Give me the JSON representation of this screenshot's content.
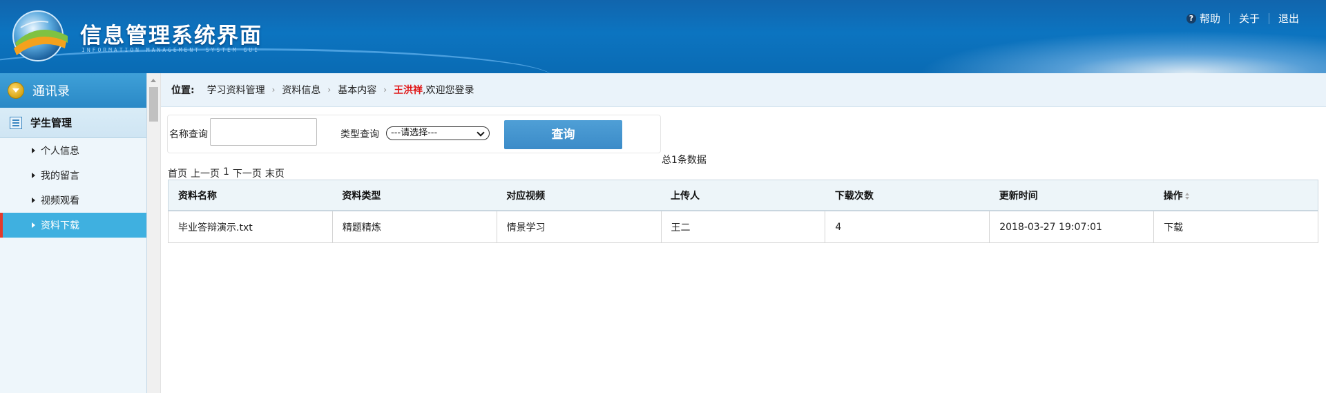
{
  "header": {
    "title": "信息管理系统界面",
    "subtitle": "INFORMATION MANAGEMENT SYSTEM GUI",
    "nav": {
      "help": "帮助",
      "about": "关于",
      "logout": "退出"
    }
  },
  "sidebar": {
    "header": "通讯录",
    "section": "学生管理",
    "items": [
      {
        "label": "个人信息"
      },
      {
        "label": "我的留言"
      },
      {
        "label": "视频观看"
      },
      {
        "label": "资料下载"
      }
    ],
    "active_index": 3
  },
  "breadcrumb": {
    "label": "位置:",
    "items": [
      "学习资料管理",
      "资料信息",
      "基本内容"
    ],
    "user": "王洪祥",
    "welcome": ",欢迎您登录"
  },
  "search": {
    "name_label": "名称查询",
    "name_value": "",
    "type_label": "类型查询",
    "type_selected": "---请选择---",
    "query_button": "查询"
  },
  "summary": {
    "total": "总1条数据"
  },
  "pager": {
    "first": "首页",
    "prev": "上一页",
    "page": "1",
    "next": "下一页",
    "last": "末页"
  },
  "table": {
    "columns": [
      "资料名称",
      "资料类型",
      "对应视频",
      "上传人",
      "下载次数",
      "更新时间",
      "操作"
    ],
    "rows": [
      [
        "毕业答辩演示.txt",
        "精题精炼",
        "情景学习",
        "王二",
        "4",
        "2018-03-27 19:07:01",
        "下载"
      ]
    ]
  },
  "colors": {
    "header_blue": "#0c74c0",
    "active_item": "#3fb0e0",
    "active_marker": "#e23a2c",
    "query_button": "#3b8bc8",
    "user_name": "#e01414"
  },
  "icons": [
    "globe-logo-icon",
    "help-icon",
    "dropdown-circle-icon",
    "list-icon",
    "arrow-right-icon",
    "sort-icon",
    "chevron-down-icon",
    "scroll-up-icon"
  ]
}
